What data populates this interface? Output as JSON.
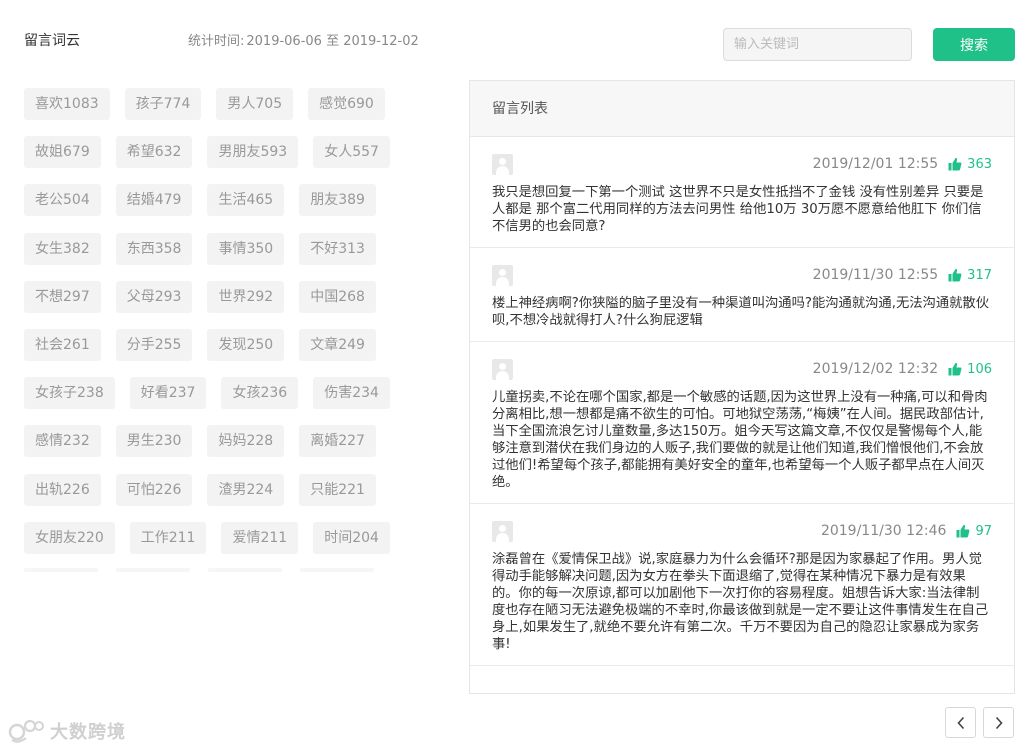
{
  "header": {
    "title": "留言词云",
    "stats_label": "统计时间:",
    "stats_range": "2019-06-06 至 2019-12-02"
  },
  "search": {
    "placeholder": "输入关键词",
    "value": "",
    "button_label": "搜索"
  },
  "word_cloud": {
    "rows": [
      [
        "喜欢1083",
        "孩子774",
        "男人705",
        "感觉690"
      ],
      [
        "故姐679",
        "希望632",
        "男朋友593",
        "女人557"
      ],
      [
        "老公504",
        "结婚479",
        "生活465",
        "朋友389"
      ],
      [
        "女生382",
        "东西358",
        "事情350",
        "不好313"
      ],
      [
        "不想297",
        "父母293",
        "世界292",
        "中国268"
      ],
      [
        "社会261",
        "分手255",
        "发现250",
        "文章249"
      ],
      [
        "女孩子238",
        "好看237",
        "女孩236",
        "伤害234"
      ],
      [
        "感情232",
        "男生230",
        "妈妈228",
        "离婚227"
      ],
      [
        "出轨226",
        "可怕226",
        "渣男224",
        "只能221"
      ],
      [
        "女朋友220",
        "工作211",
        "爱情211",
        "时间204"
      ]
    ]
  },
  "comments": {
    "title": "留言列表",
    "items": [
      {
        "time": "2019/12/01 12:55",
        "likes": "363",
        "text": "我只是想回复一下第一个测试 这世界不只是女性抵挡不了金钱 没有性别差异 只要是人都是 那个富二代用同样的方法去问男性 给他10万 30万愿不愿意给他肛下 你们信不信男的也会同意?"
      },
      {
        "time": "2019/11/30 12:55",
        "likes": "317",
        "text": "楼上神经病啊?你狭隘的脑子里没有一种渠道叫沟通吗?能沟通就沟通,无法沟通就散伙呗,不想冷战就得打人?什么狗屁逻辑"
      },
      {
        "time": "2019/12/02 12:32",
        "likes": "106",
        "text": "儿童拐卖,不论在哪个国家,都是一个敏感的话题,因为这世界上没有一种痛,可以和骨肉分离相比,想一想都是痛不欲生的可怕。可地狱空荡荡,“梅姨”在人间。据民政部估计,当下全国流浪乞讨儿童数量,多达150万。姐今天写这篇文章,不仅仅是警惕每个人,能够注意到潜伏在我们身边的人贩子,我们要做的就是让他们知道,我们憎恨他们,不会放过他们!希望每个孩子,都能拥有美好安全的童年,也希望每一个人贩子都早点在人间灭绝。"
      },
      {
        "time": "2019/11/30 12:46",
        "likes": "97",
        "text": "涂磊曾在《爱情保卫战》说,家庭暴力为什么会循环?那是因为家暴起了作用。男人觉得动手能够解决问题,因为女方在拳头下面退缩了,觉得在某种情况下暴力是有效果的。你的每一次原谅,都可以加剧他下一次打你的容易程度。姐想告诉大家:当法律制度也存在陋习无法避免极端的不幸时,你最该做到就是一定不要让这件事情发生在自己身上,如果发生了,就绝不要允许有第二次。千万不要因为自己的隐忍让家暴成为家务事!"
      }
    ]
  },
  "watermark": {
    "text": "大数跨境"
  },
  "colors": {
    "accent": "#20c089",
    "tag_bg": "#f3f3f3",
    "tag_text": "#999999"
  }
}
